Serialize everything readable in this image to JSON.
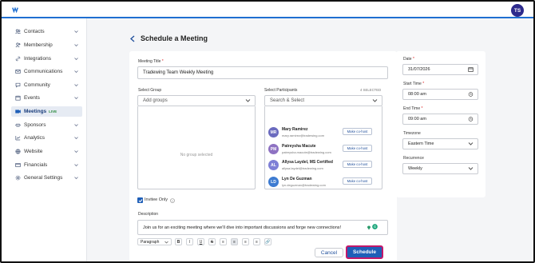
{
  "header": {
    "avatar_initials": "TS"
  },
  "sidebar": {
    "items": [
      {
        "label": "Contacts",
        "icon": "users-icon"
      },
      {
        "label": "Membership",
        "icon": "user-plus-icon"
      },
      {
        "label": "Integrations",
        "icon": "link-icon"
      },
      {
        "label": "Communications",
        "icon": "mail-icon"
      },
      {
        "label": "Community",
        "icon": "chat-icon"
      },
      {
        "label": "Events",
        "icon": "calendar-icon"
      },
      {
        "label": "Meetings",
        "badge": "LIVE",
        "icon": "video-icon",
        "active": true
      },
      {
        "label": "Sponsors",
        "icon": "handshake-icon"
      },
      {
        "label": "Analytics",
        "icon": "chart-icon"
      },
      {
        "label": "Website",
        "icon": "globe-icon"
      },
      {
        "label": "Financials",
        "icon": "card-icon"
      },
      {
        "label": "General Settings",
        "icon": "gear-icon"
      }
    ]
  },
  "page": {
    "title": "Schedule a Meeting"
  },
  "form": {
    "meeting_title_label": "Meeting Title",
    "meeting_title_value": "Tradewing Team Weekly Meeting",
    "select_group_label": "Select Group",
    "group_placeholder": "Add groups",
    "no_group_text": "No group selected",
    "participants_label": "Select Participants",
    "participants_selected": "4 SELECTED",
    "participants_placeholder": "Search & Select",
    "participants": [
      {
        "initials": "MR",
        "name": "Mary Ramirez",
        "email": "mary.ramirez@tradewing.com",
        "color": "#6b6bbf",
        "cohost": "Make co-host"
      },
      {
        "initials": "PM",
        "name": "Patreysha Macute",
        "email": "patreysha.macute@tradewing.com",
        "color": "#8e72c2",
        "cohost": "Make co-host"
      },
      {
        "initials": "AL",
        "name": "Allysa Laydel, MS Certified",
        "email": "allysa.laydel@tradewing.com",
        "color": "#7e7fd6",
        "cohost": "Make co-host"
      },
      {
        "initials": "LD",
        "name": "Lyn De Guzman",
        "email": "lyn.deguzman@tradewing.com",
        "color": "#3d7bd1",
        "cohost": "Make co-host"
      }
    ],
    "invitee_only_label": "Invitee Only",
    "description_label": "Description",
    "description_value": "Join us for an exciting meeting where we'll dive into important discussions and forge new connections!",
    "paragraph_select": "Paragraph",
    "toolbar": [
      "B",
      "I",
      "U",
      "S",
      "≡",
      "≡",
      "≡",
      "≡",
      "🔗"
    ]
  },
  "settings": {
    "date_label": "Date",
    "date_value": "31/07/2026",
    "start_label": "Start Time",
    "start_value": "08:00 am",
    "end_label": "End Time",
    "end_value": "09:00 am",
    "timezone_label": "Timezone",
    "timezone_value": "Eastern Time",
    "recurrence_label": "Recurrence",
    "recurrence_value": "Weekly"
  },
  "actions": {
    "cancel": "Cancel",
    "schedule": "Schedule"
  },
  "colors": {
    "accent": "#1f6fd1",
    "primary_button": "#1f5fb8",
    "highlight_border": "#c2186b"
  }
}
